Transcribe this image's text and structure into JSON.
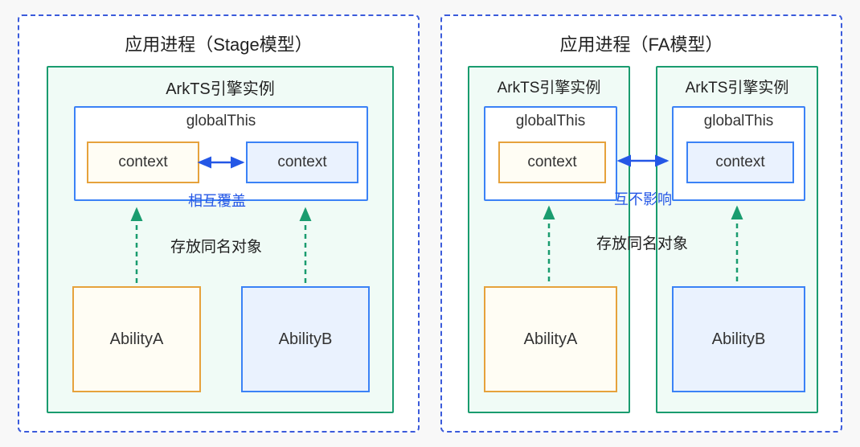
{
  "left": {
    "title": "应用进程（Stage模型）",
    "engine": "ArkTS引擎实例",
    "global": "globalThis",
    "contextA": "context",
    "contextB": "context",
    "arrowLabel": "相互覆盖",
    "note": "存放同名对象",
    "abilityA": "AbilityA",
    "abilityB": "AbilityB"
  },
  "right": {
    "title": "应用进程（FA模型）",
    "engineA": "ArkTS引擎实例",
    "engineB": "ArkTS引擎实例",
    "globalA": "globalThis",
    "globalB": "globalThis",
    "contextA": "context",
    "contextB": "context",
    "arrowLabel": "互不影响",
    "note": "存放同名对象",
    "abilityA": "AbilityA",
    "abilityB": "AbilityB"
  }
}
